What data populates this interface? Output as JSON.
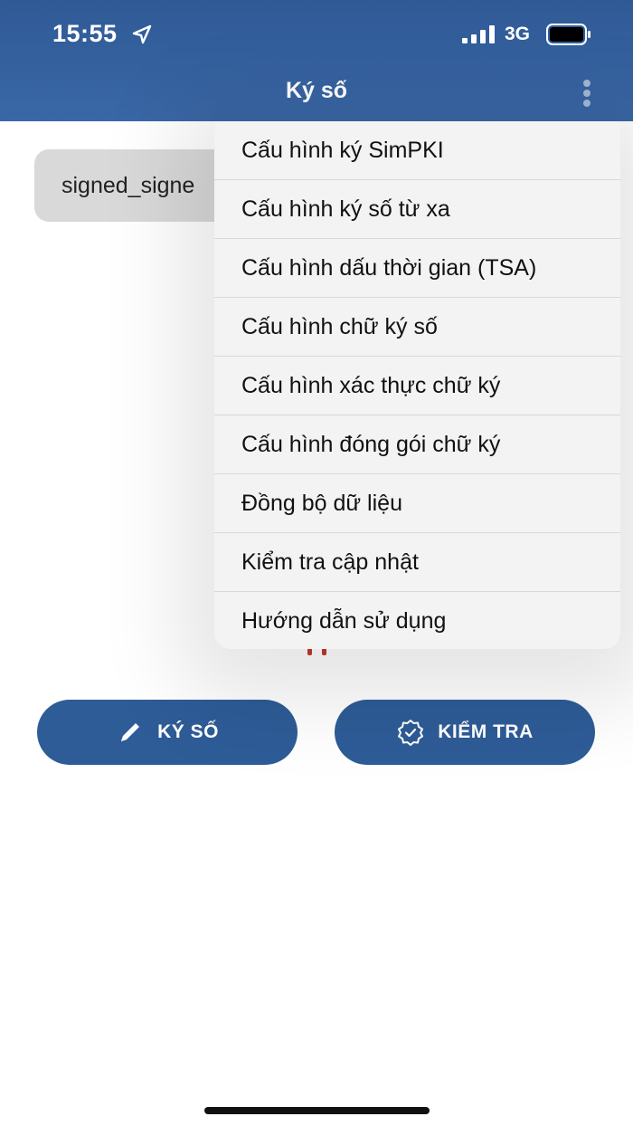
{
  "status_bar": {
    "time": "15:55",
    "network": "3G"
  },
  "header": {
    "title": "Ký số"
  },
  "file": {
    "name": "signed_signe"
  },
  "menu": {
    "items": [
      {
        "label": "Cấu hình ký SimPKI"
      },
      {
        "label": "Cấu hình ký số từ xa"
      },
      {
        "label": "Cấu hình dấu thời gian (TSA)"
      },
      {
        "label": "Cấu hình chữ ký số"
      },
      {
        "label": "Cấu hình xác thực chữ ký"
      },
      {
        "label": "Cấu hình đóng gói chữ ký"
      },
      {
        "label": "Đồng bộ dữ liệu"
      },
      {
        "label": "Kiểm tra cập nhật"
      },
      {
        "label": "Hướng dẫn sử dụng"
      }
    ]
  },
  "actions": {
    "sign_label": "KÝ SỐ",
    "check_label": "KIỂM TRA"
  },
  "colors": {
    "primary": "#2e5c97",
    "header": "#3a67a6",
    "menu_bg": "#f3f3f3"
  }
}
